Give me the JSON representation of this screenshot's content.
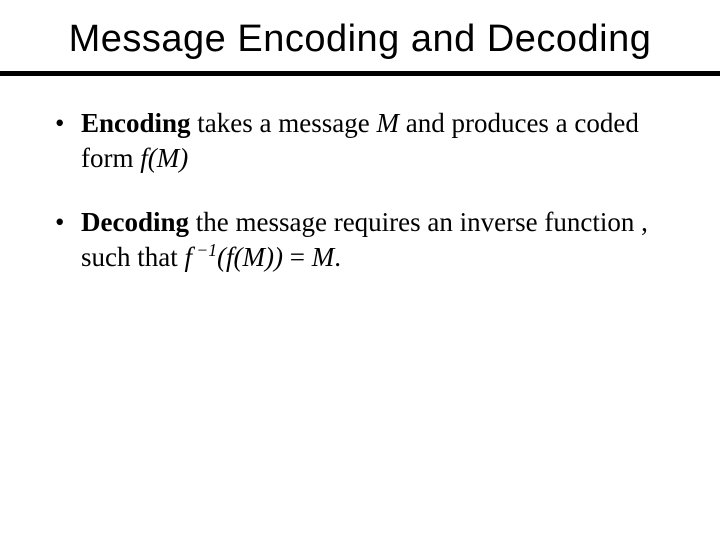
{
  "title": "Message Encoding and Decoding",
  "bullets": {
    "b1": {
      "strong": "Encoding",
      "rest1": " takes a message ",
      "m": "M",
      "rest2": " and produces a coded form ",
      "fM": "f(M)"
    },
    "b2": {
      "strong": "Decoding",
      "rest1": " the message requires an inverse function , such that ",
      "formula_f": "f",
      "formula_exp": " −1",
      "formula_open": "(",
      "formula_inner_f": "f",
      "formula_inner_open": "(",
      "formula_inner_M": "M",
      "formula_inner_close": ")",
      "formula_close": ")",
      "eq": " = ",
      "M2": "M",
      "period": "."
    }
  }
}
